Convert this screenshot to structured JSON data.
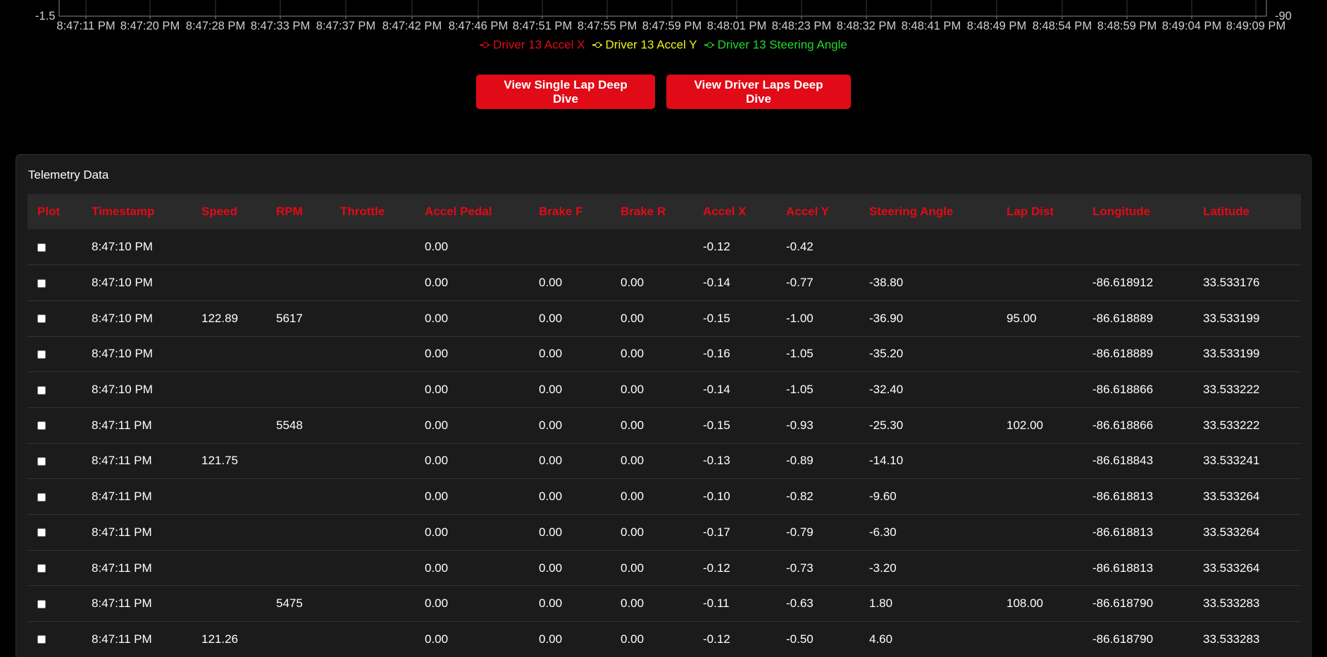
{
  "chart": {
    "y_left_tick": "-1.5",
    "y_right_tick": "-90",
    "x_ticks": [
      "8:47:11 PM",
      "8:47:20 PM",
      "8:47:28 PM",
      "8:47:33 PM",
      "8:47:37 PM",
      "8:47:42 PM",
      "8:47:46 PM",
      "8:47:51 PM",
      "8:47:55 PM",
      "8:47:59 PM",
      "8:48:01 PM",
      "8:48:23 PM",
      "8:48:32 PM",
      "8:48:41 PM",
      "8:48:49 PM",
      "8:48:54 PM",
      "8:48:59 PM",
      "8:49:04 PM",
      "8:49:09 PM"
    ]
  },
  "legend": [
    {
      "label": "Driver 13 Accel X",
      "color": "#e10b17"
    },
    {
      "label": "Driver 13 Accel Y",
      "color": "#f2f21a"
    },
    {
      "label": "Driver 13 Steering Angle",
      "color": "#22d82a"
    }
  ],
  "actions": {
    "single_lap": "View Single Lap Deep Dive",
    "driver_laps": "View Driver Laps Deep Dive"
  },
  "panel": {
    "title": "Telemetry Data",
    "columns": [
      "Plot",
      "Timestamp",
      "Speed",
      "RPM",
      "Throttle",
      "Accel Pedal",
      "Brake F",
      "Brake R",
      "Accel X",
      "Accel Y",
      "Steering Angle",
      "Lap Dist",
      "Longitude",
      "Latitude"
    ],
    "rows": [
      {
        "timestamp": "8:47:10 PM",
        "speed": "",
        "rpm": "",
        "throttle": "",
        "accel_pedal": "0.00",
        "brake_f": "",
        "brake_r": "",
        "accel_x": "-0.12",
        "accel_y": "-0.42",
        "steering": "",
        "lap_dist": "",
        "longitude": "",
        "latitude": ""
      },
      {
        "timestamp": "8:47:10 PM",
        "speed": "",
        "rpm": "",
        "throttle": "",
        "accel_pedal": "0.00",
        "brake_f": "0.00",
        "brake_r": "0.00",
        "accel_x": "-0.14",
        "accel_y": "-0.77",
        "steering": "-38.80",
        "lap_dist": "",
        "longitude": "-86.618912",
        "latitude": "33.533176"
      },
      {
        "timestamp": "8:47:10 PM",
        "speed": "122.89",
        "rpm": "5617",
        "throttle": "",
        "accel_pedal": "0.00",
        "brake_f": "0.00",
        "brake_r": "0.00",
        "accel_x": "-0.15",
        "accel_y": "-1.00",
        "steering": "-36.90",
        "lap_dist": "95.00",
        "longitude": "-86.618889",
        "latitude": "33.533199"
      },
      {
        "timestamp": "8:47:10 PM",
        "speed": "",
        "rpm": "",
        "throttle": "",
        "accel_pedal": "0.00",
        "brake_f": "0.00",
        "brake_r": "0.00",
        "accel_x": "-0.16",
        "accel_y": "-1.05",
        "steering": "-35.20",
        "lap_dist": "",
        "longitude": "-86.618889",
        "latitude": "33.533199"
      },
      {
        "timestamp": "8:47:10 PM",
        "speed": "",
        "rpm": "",
        "throttle": "",
        "accel_pedal": "0.00",
        "brake_f": "0.00",
        "brake_r": "0.00",
        "accel_x": "-0.14",
        "accel_y": "-1.05",
        "steering": "-32.40",
        "lap_dist": "",
        "longitude": "-86.618866",
        "latitude": "33.533222"
      },
      {
        "timestamp": "8:47:11 PM",
        "speed": "",
        "rpm": "5548",
        "throttle": "",
        "accel_pedal": "0.00",
        "brake_f": "0.00",
        "brake_r": "0.00",
        "accel_x": "-0.15",
        "accel_y": "-0.93",
        "steering": "-25.30",
        "lap_dist": "102.00",
        "longitude": "-86.618866",
        "latitude": "33.533222"
      },
      {
        "timestamp": "8:47:11 PM",
        "speed": "121.75",
        "rpm": "",
        "throttle": "",
        "accel_pedal": "0.00",
        "brake_f": "0.00",
        "brake_r": "0.00",
        "accel_x": "-0.13",
        "accel_y": "-0.89",
        "steering": "-14.10",
        "lap_dist": "",
        "longitude": "-86.618843",
        "latitude": "33.533241"
      },
      {
        "timestamp": "8:47:11 PM",
        "speed": "",
        "rpm": "",
        "throttle": "",
        "accel_pedal": "0.00",
        "brake_f": "0.00",
        "brake_r": "0.00",
        "accel_x": "-0.10",
        "accel_y": "-0.82",
        "steering": "-9.60",
        "lap_dist": "",
        "longitude": "-86.618813",
        "latitude": "33.533264"
      },
      {
        "timestamp": "8:47:11 PM",
        "speed": "",
        "rpm": "",
        "throttle": "",
        "accel_pedal": "0.00",
        "brake_f": "0.00",
        "brake_r": "0.00",
        "accel_x": "-0.17",
        "accel_y": "-0.79",
        "steering": "-6.30",
        "lap_dist": "",
        "longitude": "-86.618813",
        "latitude": "33.533264"
      },
      {
        "timestamp": "8:47:11 PM",
        "speed": "",
        "rpm": "",
        "throttle": "",
        "accel_pedal": "0.00",
        "brake_f": "0.00",
        "brake_r": "0.00",
        "accel_x": "-0.12",
        "accel_y": "-0.73",
        "steering": "-3.20",
        "lap_dist": "",
        "longitude": "-86.618813",
        "latitude": "33.533264"
      },
      {
        "timestamp": "8:47:11 PM",
        "speed": "",
        "rpm": "5475",
        "throttle": "",
        "accel_pedal": "0.00",
        "brake_f": "0.00",
        "brake_r": "0.00",
        "accel_x": "-0.11",
        "accel_y": "-0.63",
        "steering": "1.80",
        "lap_dist": "108.00",
        "longitude": "-86.618790",
        "latitude": "33.533283"
      },
      {
        "timestamp": "8:47:11 PM",
        "speed": "121.26",
        "rpm": "",
        "throttle": "",
        "accel_pedal": "0.00",
        "brake_f": "0.00",
        "brake_r": "0.00",
        "accel_x": "-0.12",
        "accel_y": "-0.50",
        "steering": "4.60",
        "lap_dist": "",
        "longitude": "-86.618790",
        "latitude": "33.533283"
      }
    ]
  }
}
